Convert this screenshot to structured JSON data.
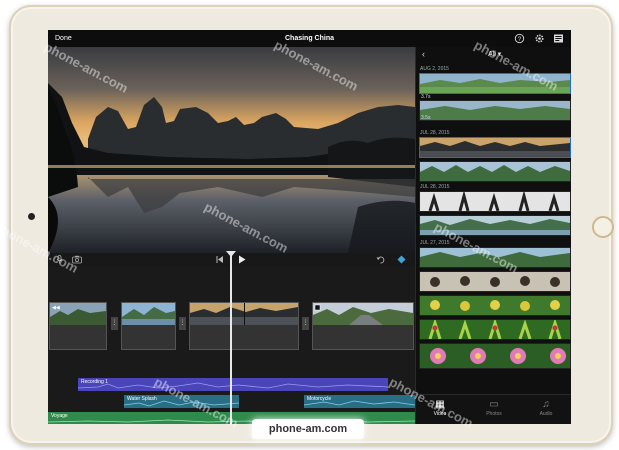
{
  "app": {
    "title": "Chasing China",
    "done_label": "Done",
    "help_icon": "help-icon",
    "settings_icon": "gear-icon",
    "project_icon": "project-settings-icon"
  },
  "library": {
    "filter_label": "All ▾",
    "dates": [
      "AUG 2, 2015",
      "JUL 28, 2015",
      "JUL 28, 2015",
      "JUL 27, 2015"
    ],
    "durations": [
      "3.7s",
      "3.5s"
    ],
    "tabs": [
      {
        "label": "Video",
        "icon": "video-icon",
        "active": true
      },
      {
        "label": "Photos",
        "icon": "photos-icon",
        "active": false
      },
      {
        "label": "Audio",
        "icon": "audio-icon",
        "active": false
      }
    ]
  },
  "timeline": {
    "tracks": [
      {
        "label": "Recording 1",
        "color": "#4a45b8"
      },
      {
        "label": "Water Splash",
        "color": "#2a6e86"
      },
      {
        "label": "Motorcycle",
        "color": "#2a6e86"
      },
      {
        "label": "Voyage",
        "color": "#2f8b4c"
      }
    ]
  },
  "watermarks": {
    "text": "phone-am.com",
    "bottom": "phone-am.com"
  }
}
